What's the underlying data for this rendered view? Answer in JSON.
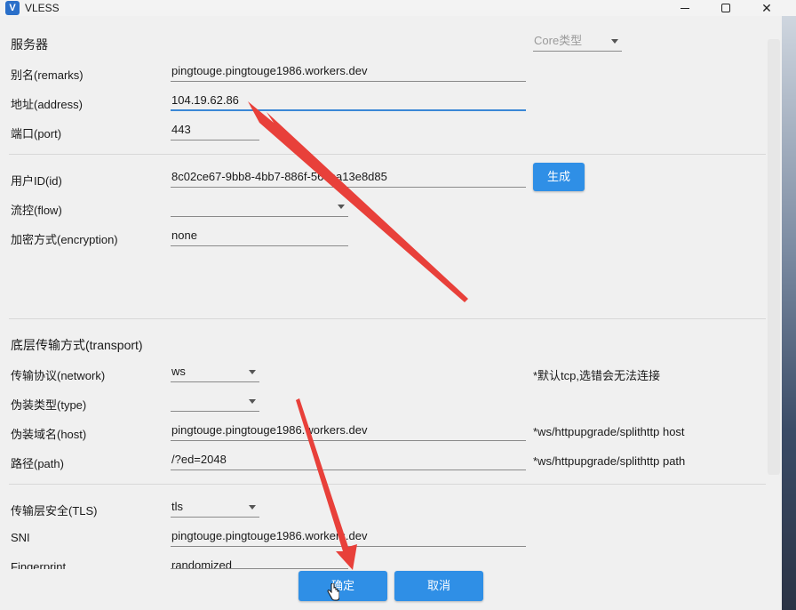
{
  "window": {
    "title": "VLESS",
    "icon": "v-app-icon"
  },
  "server": {
    "section_title": "服务器",
    "core_type": {
      "placeholder": "Core类型"
    },
    "remarks": {
      "label": "别名(remarks)",
      "value": "pingtouge.pingtouge1986.workers.dev"
    },
    "address": {
      "label": "地址(address)",
      "value": "104.19.62.86"
    },
    "port": {
      "label": "端口(port)",
      "value": "443"
    }
  },
  "user": {
    "id": {
      "label": "用户ID(id)",
      "value": "8c02ce67-9bb8-4bb7-886f-56cba13e8d85"
    },
    "generate_label": "生成",
    "flow": {
      "label": "流控(flow)",
      "value": ""
    },
    "encryption": {
      "label": "加密方式(encryption)",
      "value": "none"
    }
  },
  "transport": {
    "section_title": "底层传输方式(transport)",
    "network": {
      "label": "传输协议(network)",
      "value": "ws",
      "hint": "*默认tcp,选错会无法连接"
    },
    "type": {
      "label": "伪装类型(type)",
      "value": ""
    },
    "host": {
      "label": "伪装域名(host)",
      "value": "pingtouge.pingtouge1986.workers.dev",
      "hint": "*ws/httpupgrade/splithttp host"
    },
    "path": {
      "label": "路径(path)",
      "value": "/?ed=2048",
      "hint": "*ws/httpupgrade/splithttp path"
    }
  },
  "tls": {
    "security": {
      "label": "传输层安全(TLS)",
      "value": "tls"
    },
    "sni": {
      "label": "SNI",
      "value": "pingtouge.pingtouge1986.workers.dev"
    },
    "fingerprint": {
      "label": "Fingerprint",
      "value": "randomized"
    }
  },
  "actions": {
    "ok_label": "确定",
    "cancel_label": "取消"
  },
  "colors": {
    "accent": "#2f8fe6",
    "annotation": "#e8403a"
  }
}
